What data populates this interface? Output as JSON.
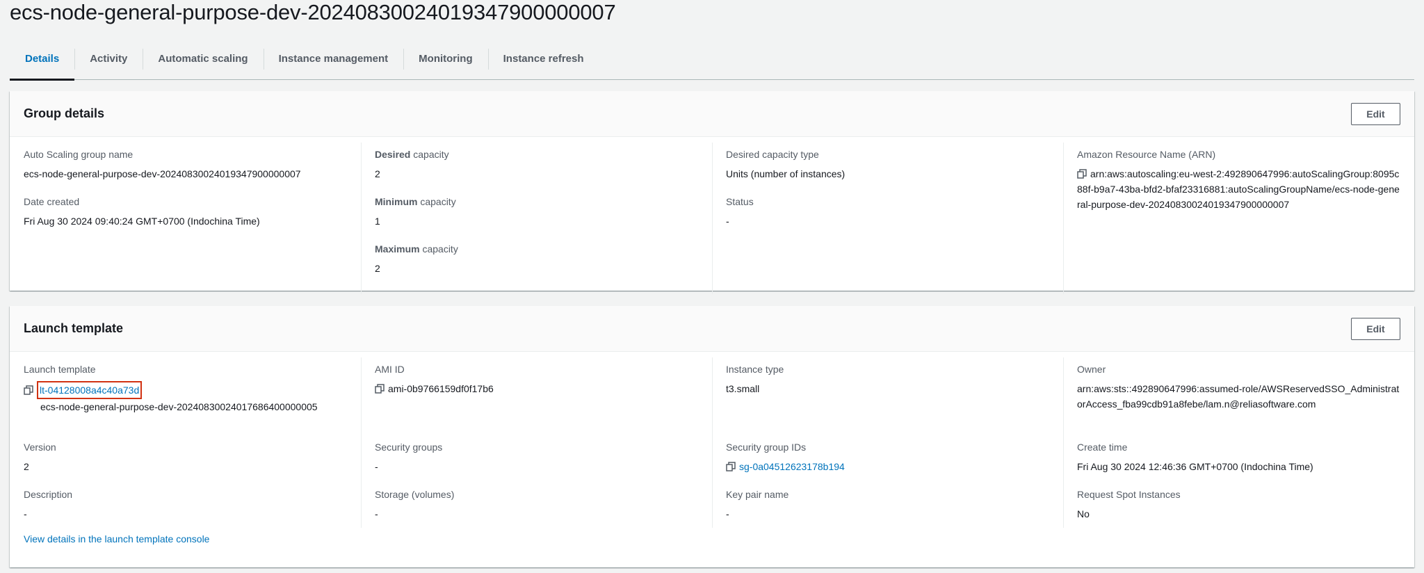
{
  "page": {
    "title": "ecs-node-general-purpose-dev-20240830024019347900000007"
  },
  "tabs": [
    {
      "label": "Details",
      "active": true
    },
    {
      "label": "Activity",
      "active": false
    },
    {
      "label": "Automatic scaling",
      "active": false
    },
    {
      "label": "Instance management",
      "active": false
    },
    {
      "label": "Monitoring",
      "active": false
    },
    {
      "label": "Instance refresh",
      "active": false
    }
  ],
  "group_details": {
    "title": "Group details",
    "edit_label": "Edit",
    "asg_name_label": "Auto Scaling group name",
    "asg_name": "ecs-node-general-purpose-dev-20240830024019347900000007",
    "date_created_label": "Date created",
    "date_created": "Fri Aug 30 2024 09:40:24 GMT+0700 (Indochina Time)",
    "desired_capacity_label_bold": "Desired",
    "desired_capacity_label_rest": " capacity",
    "desired_capacity": "2",
    "minimum_capacity_label_bold": "Minimum",
    "minimum_capacity_label_rest": " capacity",
    "minimum_capacity": "1",
    "maximum_capacity_label_bold": "Maximum",
    "maximum_capacity_label_rest": " capacity",
    "maximum_capacity": "2",
    "desired_capacity_type_label": "Desired capacity type",
    "desired_capacity_type": "Units (number of instances)",
    "status_label": "Status",
    "status": "-",
    "arn_label": "Amazon Resource Name (ARN)",
    "arn": "arn:aws:autoscaling:eu-west-2:492890647996:autoScalingGroup:8095c88f-b9a7-43ba-bfd2-bfaf23316881:autoScalingGroupName/ecs-node-general-purpose-dev-20240830024019347900000007"
  },
  "launch_template": {
    "title": "Launch template",
    "edit_label": "Edit",
    "template_label": "Launch template",
    "template_id": "lt-04128008a4c40a73d",
    "template_name": "ecs-node-general-purpose-dev-20240830024017686400000005",
    "version_label": "Version",
    "version": "2",
    "description_label": "Description",
    "description": "-",
    "ami_id_label": "AMI ID",
    "ami_id": "ami-0b9766159df0f17b6",
    "security_groups_label": "Security groups",
    "security_groups": "-",
    "storage_label": "Storage (volumes)",
    "storage": "-",
    "instance_type_label": "Instance type",
    "instance_type": "t3.small",
    "security_group_ids_label": "Security group IDs",
    "security_group_id": "sg-0a04512623178b194",
    "key_pair_label": "Key pair name",
    "key_pair": "-",
    "owner_label": "Owner",
    "owner": "arn:aws:sts::492890647996:assumed-role/AWSReservedSSO_AdministratorAccess_fba99cdb91a8febe/lam.n@reliasoftware.com",
    "create_time_label": "Create time",
    "create_time": "Fri Aug 30 2024 12:46:36 GMT+0700 (Indochina Time)",
    "spot_label": "Request Spot Instances",
    "spot": "No",
    "view_details_link": "View details in the launch template console"
  },
  "colors": {
    "link": "#0073bb",
    "highlight": "#d13212",
    "active_tab": "#0073bb"
  }
}
